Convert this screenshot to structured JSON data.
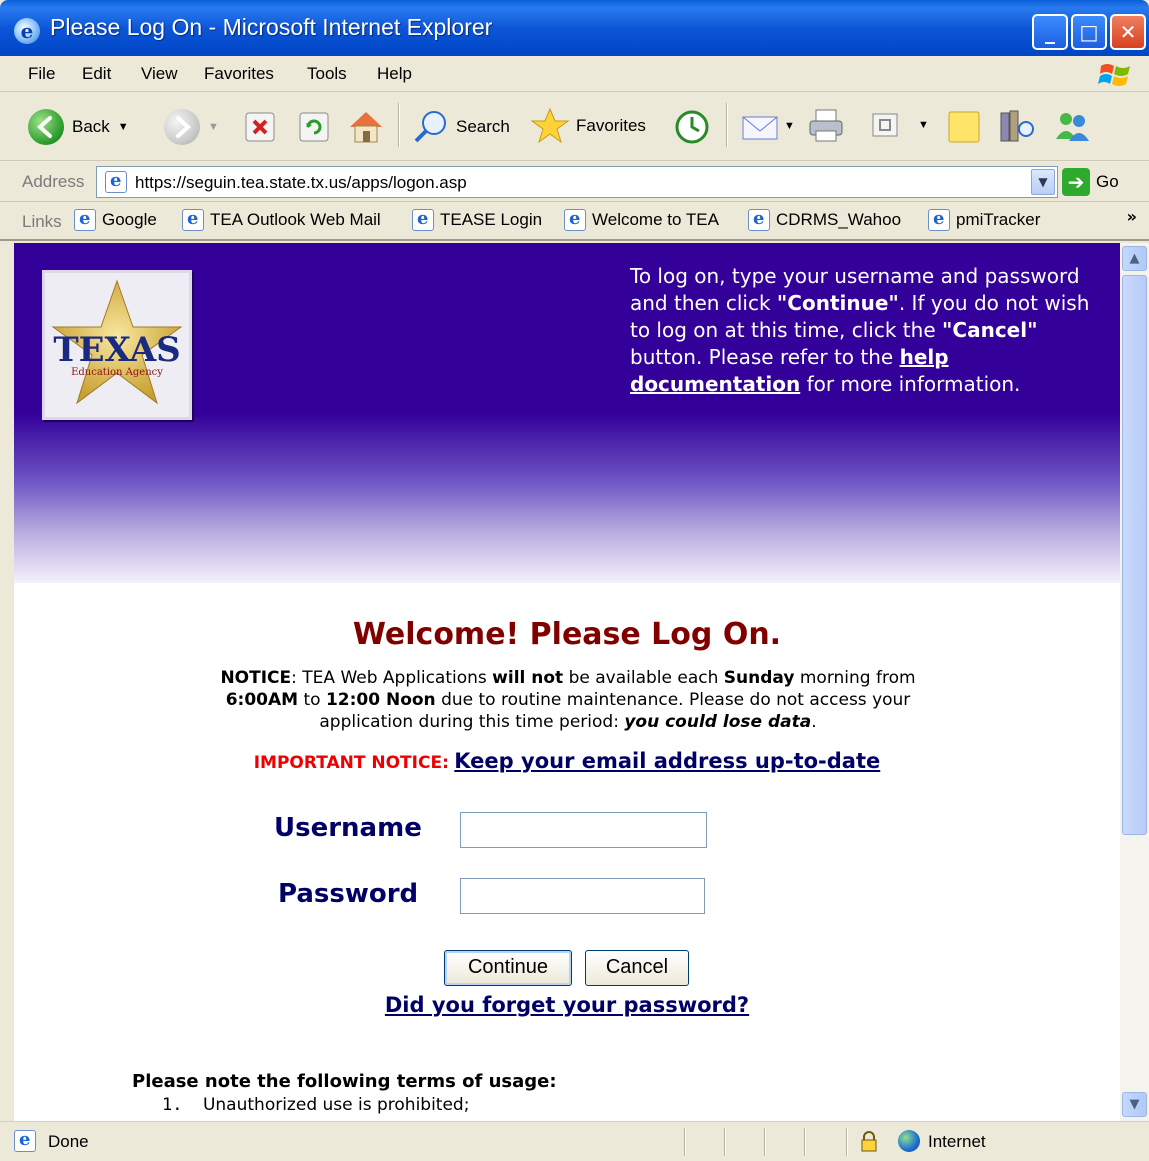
{
  "window": {
    "title": "Please Log On - Microsoft Internet Explorer",
    "minimize": "_",
    "maximize": "□",
    "close": "✕"
  },
  "menu": [
    "File",
    "Edit",
    "View",
    "Favorites",
    "Tools",
    "Help"
  ],
  "toolbar": {
    "back": "Back",
    "search": "Search",
    "favorites": "Favorites"
  },
  "address": {
    "label": "Address",
    "url": "https://seguin.tea.state.tx.us/apps/logon.asp",
    "go": "Go"
  },
  "links": {
    "label": "Links",
    "items": [
      "Google",
      "TEA Outlook Web Mail",
      "TEASE Login",
      "Welcome to TEA",
      "CDRMS_Wahoo",
      "pmiTracker"
    ],
    "more": "»"
  },
  "banner": {
    "logo_text": "TEXAS",
    "logo_subtext": "Education Agency",
    "instructions_1": "To log on, type your username and password and then click ",
    "continue_quote": "\"Continue\"",
    "instructions_2": ". If you do not wish to log on at this time, click the ",
    "cancel_quote": "\"Cancel\"",
    "instructions_3": " button. Please refer to the ",
    "help_link": "help documentation",
    "instructions_4": " for more information."
  },
  "page": {
    "welcome": "Welcome! Please Log On.",
    "notice_label": "NOTICE",
    "notice_1": ": TEA Web Applications ",
    "will_not": "will not",
    "notice_2": " be available each ",
    "sunday": "Sunday",
    "notice_3": " morning from ",
    "time_start": "6:00AM",
    "notice_4": " to ",
    "time_end": "12:00 Noon",
    "notice_5": " due to routine maintenance. Please do not access your application during this time period: ",
    "lose_data": "you could lose data",
    "notice_6": ".",
    "important_label": "IMPORTANT NOTICE:",
    "email_link": "Keep your email address up-to-date",
    "username_label": "Username",
    "password_label": "Password",
    "username_value": "",
    "password_value": "",
    "continue_btn": "Continue",
    "cancel_btn": "Cancel",
    "forgot_link": "Did you forget your password?",
    "terms_heading": "Please note the following terms of usage:",
    "terms": [
      {
        "num": "1.",
        "text": "Unauthorized use is prohibited;"
      }
    ]
  },
  "status": {
    "text": "Done",
    "zone": "Internet"
  },
  "colors": {
    "banner": "#330099",
    "welcome": "#800000",
    "label": "#000066",
    "important": "#ee0000"
  }
}
